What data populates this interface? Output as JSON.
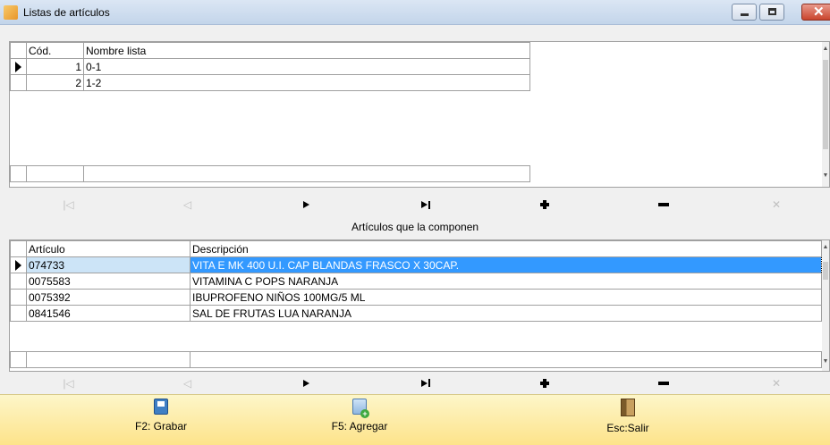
{
  "window": {
    "title": "Listas de artículos",
    "close_glyph": "✕"
  },
  "lists_grid": {
    "columns": [
      "Cód.",
      "Nombre lista"
    ],
    "rows": [
      {
        "code": "1",
        "name": "0-1"
      },
      {
        "code": "2",
        "name": "1-2"
      }
    ]
  },
  "navigator": {
    "first_glyph": "|◁",
    "prev_glyph": "◁",
    "cancel_glyph": "✕"
  },
  "section": {
    "label": "Artículos que la componen"
  },
  "articles_grid": {
    "columns": [
      "Artículo",
      "Descripción"
    ],
    "rows": [
      {
        "code": "074733",
        "description": "VITA E MK 400 U.I. CAP BLANDAS FRASCO X 30CAP."
      },
      {
        "code": "0075583",
        "description": "VITAMINA C POPS NARANJA"
      },
      {
        "code": "0075392",
        "description": "IBUPROFENO NIÑOS 100MG/5 ML"
      },
      {
        "code": "0841546",
        "description": "SAL DE FRUTAS LUA NARANJA"
      }
    ]
  },
  "toolbar": {
    "save_label": "F2: Grabar",
    "add_label": "F5: Agregar",
    "exit_label": "Esc:Salir"
  },
  "colors": {
    "selection": "#3399ff",
    "toolbar_top": "#fdf6c9",
    "toolbar_bottom": "#fde38a"
  },
  "icons": [
    "app-icon",
    "minimize-icon",
    "maximize-icon",
    "close-icon",
    "save-icon",
    "add-document-icon",
    "exit-door-icon"
  ]
}
